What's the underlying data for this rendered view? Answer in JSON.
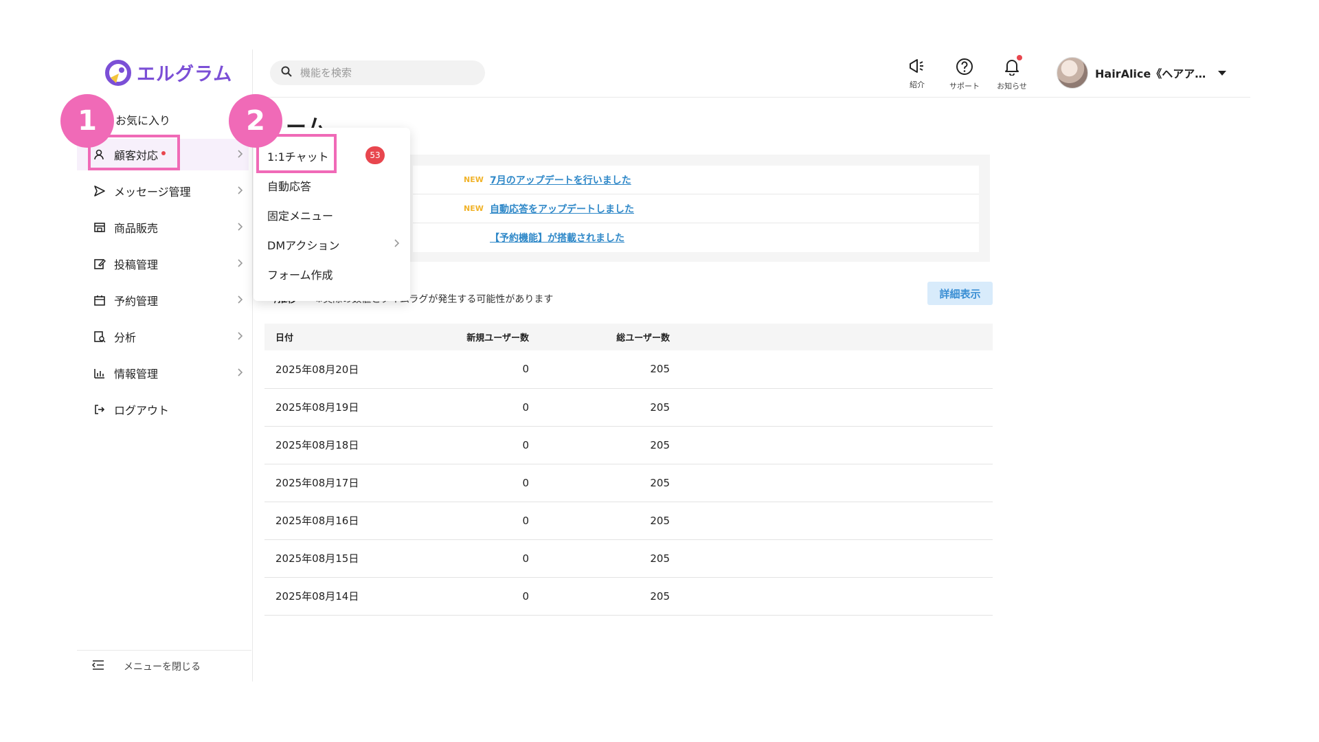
{
  "app": {
    "logo_text": "エルグラム"
  },
  "search": {
    "placeholder": "機能を検索"
  },
  "header_icons": [
    {
      "label": "紹介",
      "icon": "megaphone-icon"
    },
    {
      "label": "サポート",
      "icon": "help-circle-icon"
    },
    {
      "label": "お知らせ",
      "icon": "bell-icon"
    }
  ],
  "user": {
    "name": "HairAlice《ヘアア…"
  },
  "sidebar": {
    "favorites": "お気に入り",
    "items": [
      {
        "label": "顧客対応",
        "icon": "user-icon"
      },
      {
        "label": "メッセージ管理",
        "icon": "send-icon"
      },
      {
        "label": "商品販売",
        "icon": "store-icon"
      },
      {
        "label": "投稿管理",
        "icon": "edit-icon"
      },
      {
        "label": "予約管理",
        "icon": "calendar-icon"
      },
      {
        "label": "分析",
        "icon": "analytics-icon"
      },
      {
        "label": "情報管理",
        "icon": "bar-chart-icon"
      },
      {
        "label": "ログアウト",
        "icon": "logout-icon"
      }
    ],
    "close_menu": "メニューを閉じる"
  },
  "steps": {
    "one": "1",
    "two": "2"
  },
  "page": {
    "title_fragment": "ーム"
  },
  "dropdown": {
    "items": [
      {
        "label": "1:1チャット"
      },
      {
        "label": "自動応答"
      },
      {
        "label": "固定メニュー"
      },
      {
        "label": "DMアクション"
      },
      {
        "label": "フォーム作成"
      }
    ],
    "chat_badge": "53"
  },
  "notices": [
    {
      "badge": "NEW",
      "text": "7月のアップデートを行いました"
    },
    {
      "badge": "NEW",
      "text": "自動応答をアップデートしました"
    },
    {
      "badge": "",
      "text": "【予約機能】が搭載されました"
    }
  ],
  "stats": {
    "title_fragment": "ー/推移",
    "note": "※実際の数値とタイムラグが発生する可能性があります",
    "detail_button": "詳細表示",
    "columns": [
      "日付",
      "新規ユーザー数",
      "総ユーザー数"
    ],
    "rows": [
      [
        "2025年08月20日",
        "0",
        "205"
      ],
      [
        "2025年08月19日",
        "0",
        "205"
      ],
      [
        "2025年08月18日",
        "0",
        "205"
      ],
      [
        "2025年08月17日",
        "0",
        "205"
      ],
      [
        "2025年08月16日",
        "0",
        "205"
      ],
      [
        "2025年08月15日",
        "0",
        "205"
      ],
      [
        "2025年08月14日",
        "0",
        "205"
      ]
    ]
  },
  "colors": {
    "accent": "#7b4fd6",
    "highlight": "#f06ab7",
    "badge": "#e8464e",
    "link": "#2f88c8"
  }
}
